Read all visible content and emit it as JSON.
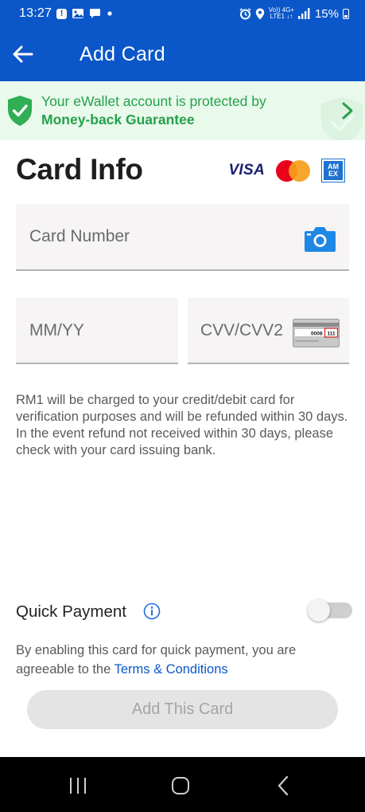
{
  "status_bar": {
    "time": "13:27",
    "network_top": "Vo)) 4G+",
    "network_bottom": "LTE1 ↓↑",
    "battery": "15%"
  },
  "app_bar": {
    "title": "Add Card",
    "back_icon": "arrow-left-icon"
  },
  "banner": {
    "line1": "Your eWallet account is protected by",
    "line2": "Money-back Guarantee",
    "icon": "shield-check-icon",
    "accent_color": "#26a04a",
    "background": "#e9f9ec"
  },
  "card_info": {
    "title": "Card Info",
    "brands": {
      "visa": "VISA",
      "mastercard": "mastercard-logo",
      "amex": "AM EX"
    }
  },
  "fields": {
    "card_number": {
      "placeholder": "Card Number",
      "value": ""
    },
    "expiry": {
      "placeholder": "MM/YY",
      "value": ""
    },
    "cvv": {
      "placeholder": "CVV/CVV2",
      "value": "",
      "hint_digits": "0008",
      "hint_cvv": "111"
    }
  },
  "disclaimer": "RM1 will be charged to your credit/debit card for verification purposes and will be refunded within 30 days. In the event refund not received within 30 days, please check with your card issuing bank.",
  "quick_payment": {
    "label": "Quick Payment",
    "enabled": false,
    "description_prefix": "By enabling this card for quick payment, you are agreeable to the ",
    "link_text": "Terms & Conditions"
  },
  "add_button": {
    "label": "Add This Card",
    "enabled": false
  },
  "colors": {
    "primary": "#0b57c9",
    "link": "#0b57c9",
    "disabled_button": "#e4e4e4"
  }
}
